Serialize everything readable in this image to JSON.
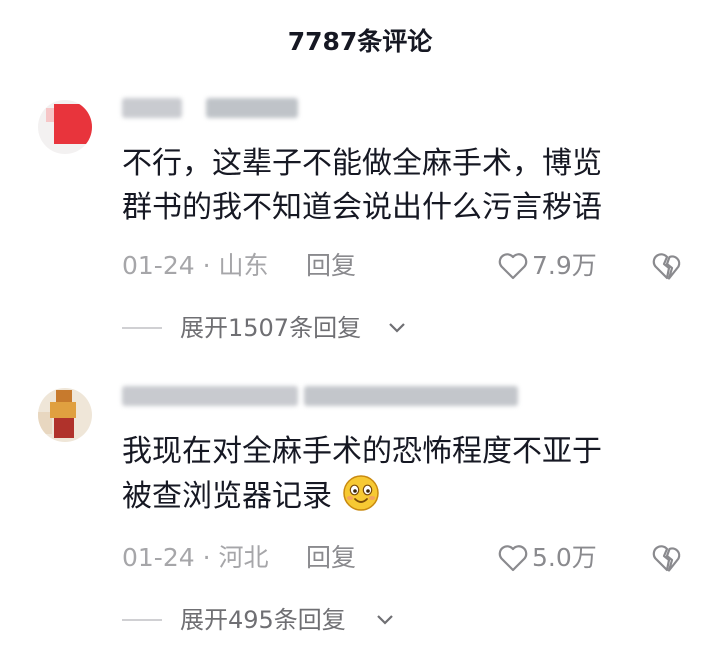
{
  "header": {
    "title": "7787条评论"
  },
  "comments": [
    {
      "text_line1": "不行，这辈子不能做全麻手术，博览",
      "text_line2": "群书的我不知道会说出什么污言秽语",
      "date": "01-24 · 山东",
      "reply_label": "回复",
      "likes": "7.9万",
      "expand_label": "展开1507条回复"
    },
    {
      "text_line1": "我现在对全麻手术的恐怖程度不亚于",
      "text_line2": "被查浏览器记录",
      "date": "01-24 · 河北",
      "reply_label": "回复",
      "likes": "5.0万",
      "expand_label": "展开495条回复"
    }
  ],
  "icons": {
    "like": "heart-outline-icon",
    "dislike": "broken-heart-icon",
    "expand": "chevron-down-icon",
    "emoji": "smiling-face-emoji"
  },
  "colors": {
    "text": "#161823",
    "meta": "#a6a6a9",
    "secondary": "#8a8a8e"
  }
}
